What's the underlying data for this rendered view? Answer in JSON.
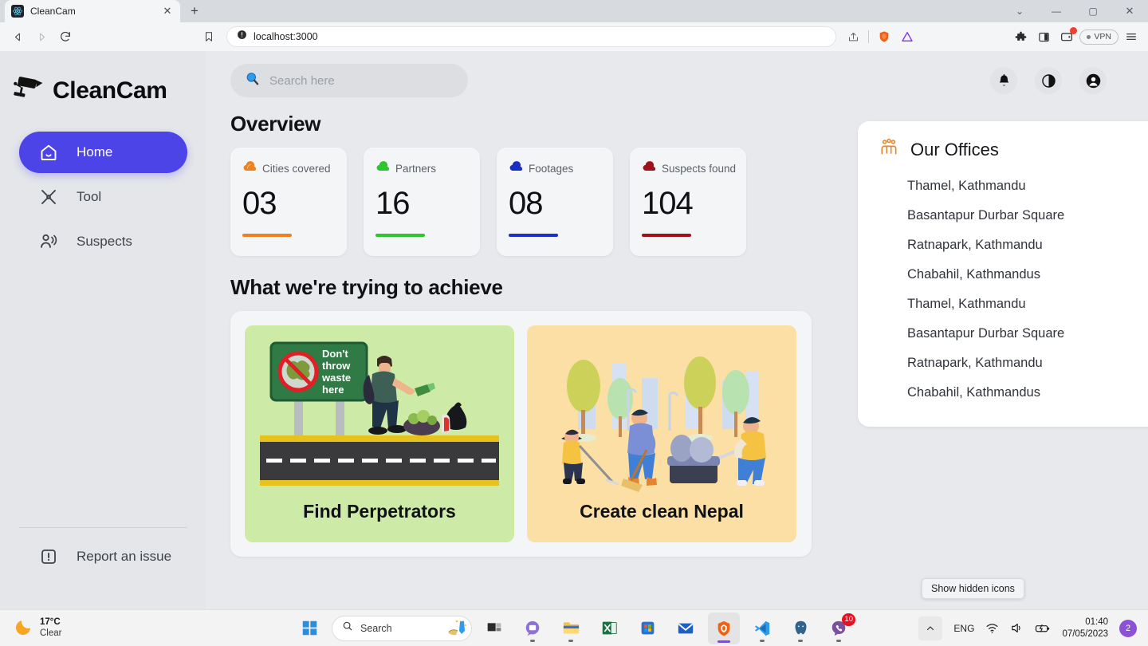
{
  "browser": {
    "tab": {
      "title": "CleanCam",
      "favicon": "react-icon",
      "close": "✕"
    },
    "new_tab": "+",
    "window_controls": {
      "tab_search": "⌄",
      "minimize": "—",
      "maximize": "▢",
      "close": "✕"
    },
    "nav": {
      "back": "◁",
      "forward": "▷",
      "reload": "⟳",
      "bookmark": "bookmark-icon"
    },
    "url": "localhost:3000",
    "url_security_icon": "info-circle-icon",
    "toolbar": {
      "share": "share-icon",
      "brave_shield": "brave-shield-icon",
      "triangle": "triangle-icon",
      "extensions": "puzzle-icon",
      "sidebar": "panel-icon",
      "wallet": "wallet-icon",
      "vpn_label": "VPN",
      "menu": "hamburger-icon"
    }
  },
  "sidebar": {
    "brand": "CleanCam",
    "brand_icon": "security-camera-icon",
    "items": [
      {
        "label": "Home",
        "icon": "home-icon",
        "active": true
      },
      {
        "label": "Tool",
        "icon": "tools-icon",
        "active": false
      },
      {
        "label": "Suspects",
        "icon": "person-signal-icon",
        "active": false
      }
    ],
    "footer": {
      "label": "Report an issue",
      "icon": "alert-square-icon"
    }
  },
  "header": {
    "search_placeholder": "Search here",
    "search_icon": "magnifier-icon",
    "icons": [
      {
        "name": "notification-bell-icon",
        "glyph": "🔔"
      },
      {
        "name": "theme-toggle-icon",
        "glyph": "◑"
      },
      {
        "name": "account-avatar-icon",
        "glyph": "person"
      }
    ]
  },
  "main": {
    "overview_title": "Overview",
    "achieve_title": "What we're trying to achieve",
    "stats": [
      {
        "label": "Cities covered",
        "value": "03",
        "color": "#ef8020",
        "icon": "cloud-leaf-icon"
      },
      {
        "label": "Partners",
        "value": "16",
        "color": "#2ec62e",
        "icon": "cloud-leaf-icon"
      },
      {
        "label": "Footages",
        "value": "08",
        "color": "#1b2fc4",
        "icon": "cloud-leaf-icon"
      },
      {
        "label": "Suspects found",
        "value": "104",
        "color": "#a4101a",
        "icon": "cloud-leaf-icon"
      }
    ],
    "tiles": [
      {
        "title": "Find Perpetrators",
        "bg": "#cdeaa6",
        "illustration": "littering-road-sign-illustration",
        "sign_text": [
          "Don't",
          "throw",
          "waste",
          "here"
        ]
      },
      {
        "title": "Create clean Nepal",
        "bg": "#fbdfa4",
        "illustration": "community-cleanup-illustration"
      }
    ]
  },
  "offices": {
    "title": "Our Offices",
    "icon": "people-group-icon",
    "items": [
      "Thamel, Kathmandu",
      "Basantapur Durbar Square",
      "Ratnapark, Kathmandu",
      "Chabahil, Kathmandus",
      "Thamel, Kathmandu",
      "Basantapur Durbar Square",
      "Ratnapark, Kathmandu",
      "Chabahil, Kathmandus"
    ]
  },
  "tooltip": {
    "text": "Show hidden icons"
  },
  "taskbar": {
    "weather": {
      "temp": "17°C",
      "condition": "Clear",
      "icon": "crescent-moon-icon"
    },
    "start_icon": "windows-start-icon",
    "search_label": "Search",
    "search_icon": "magnifier-icon",
    "apps": [
      {
        "name": "task-view-icon"
      },
      {
        "name": "chat-icon"
      },
      {
        "name": "file-explorer-icon"
      },
      {
        "name": "excel-icon"
      },
      {
        "name": "microsoft-store-icon"
      },
      {
        "name": "mail-icon"
      },
      {
        "name": "brave-browser-icon"
      },
      {
        "name": "vscode-icon"
      },
      {
        "name": "postgresql-icon"
      },
      {
        "name": "viber-icon",
        "badge": "10"
      }
    ],
    "tray": {
      "show_hidden": "⌃",
      "language": "ENG",
      "wifi": "wifi-icon",
      "volume": "volume-icon",
      "battery": "battery-charging-icon",
      "time": "01:40",
      "date": "07/05/2023",
      "notification_count": "2"
    }
  }
}
